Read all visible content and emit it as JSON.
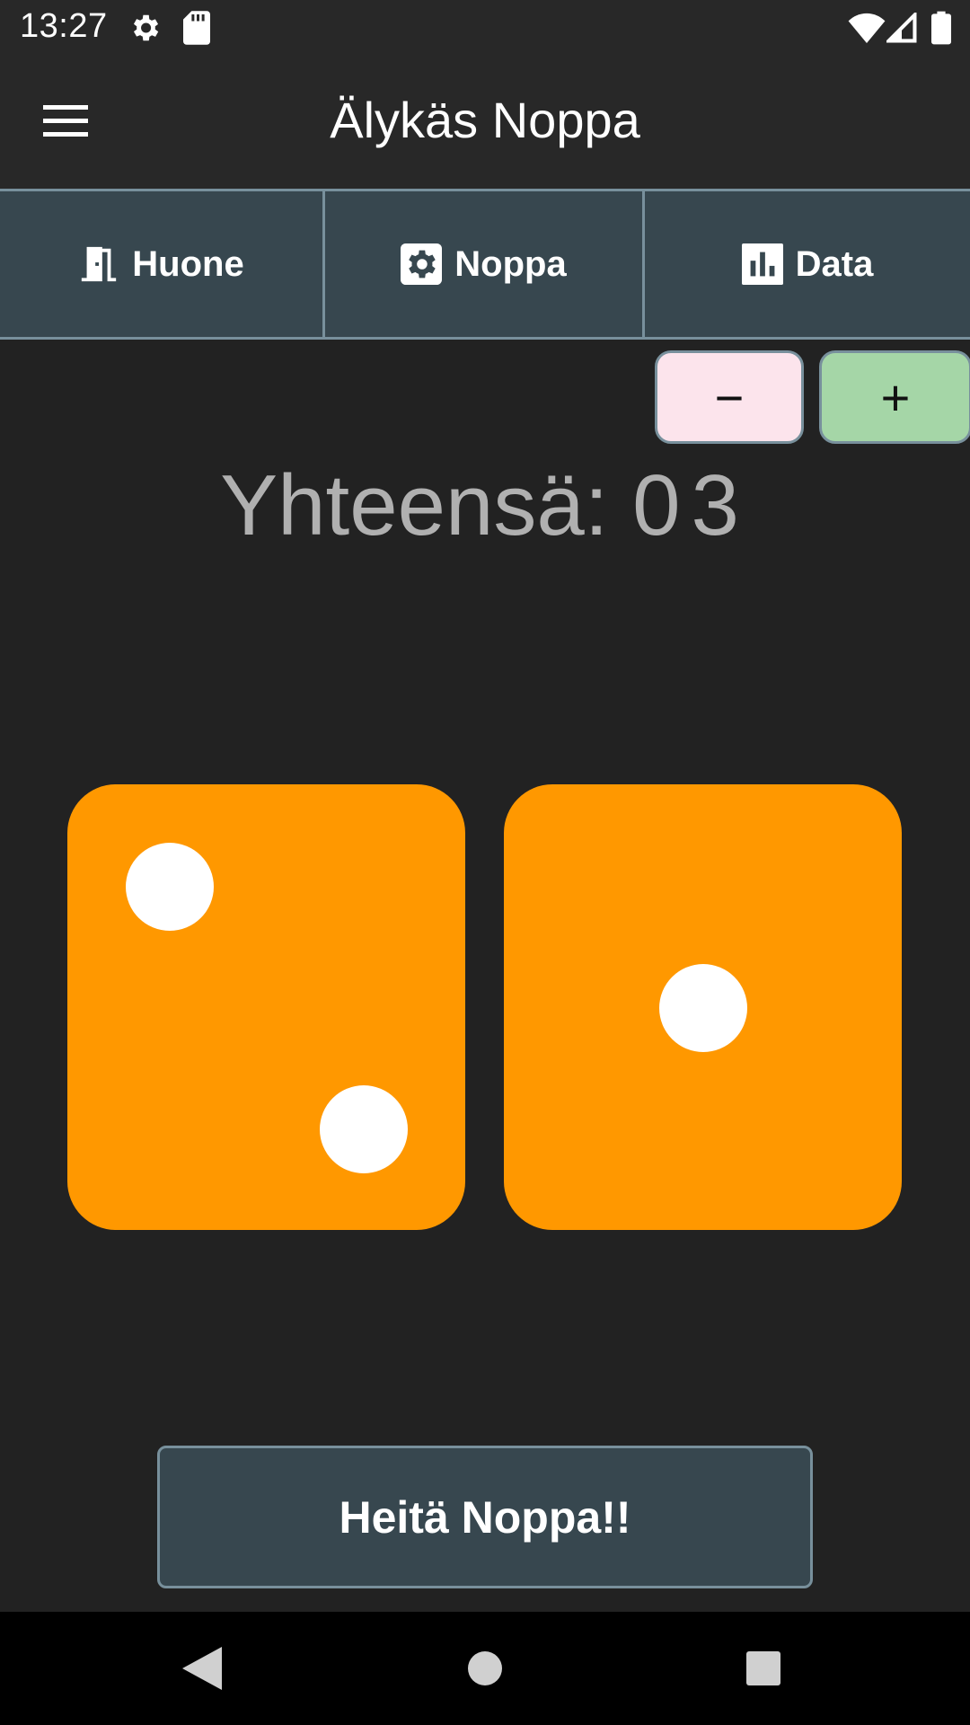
{
  "status_bar": {
    "time": "13:27",
    "icons": [
      "gear-icon",
      "sd-card-icon",
      "wifi-icon",
      "signal-icon",
      "battery-icon"
    ]
  },
  "app_bar": {
    "title": "Älykäs Noppa",
    "menu_icon": "hamburger-menu-icon"
  },
  "tabs": [
    {
      "label": "Huone",
      "icon": "door-icon"
    },
    {
      "label": "Noppa",
      "icon": "settings-gear-icon"
    },
    {
      "label": "Data",
      "icon": "bar-chart-icon"
    }
  ],
  "controls": {
    "minus_label": "−",
    "plus_label": "+",
    "minus_color": "#fce4ec",
    "plus_color": "#a5d6a7"
  },
  "total": {
    "label": "Yhteensä:",
    "value": "03"
  },
  "dice": [
    {
      "value": 2,
      "color": "#ff9800"
    },
    {
      "value": 1,
      "color": "#ff9800"
    }
  ],
  "roll_button": {
    "label": "Heitä Noppa!!"
  },
  "nav_bar": {
    "buttons": [
      "back-icon",
      "home-icon",
      "recents-icon"
    ]
  },
  "colors": {
    "background": "#222222",
    "tab_bar": "#37474f",
    "border": "#78909c",
    "die": "#ff9800",
    "pip": "#ffffff"
  }
}
